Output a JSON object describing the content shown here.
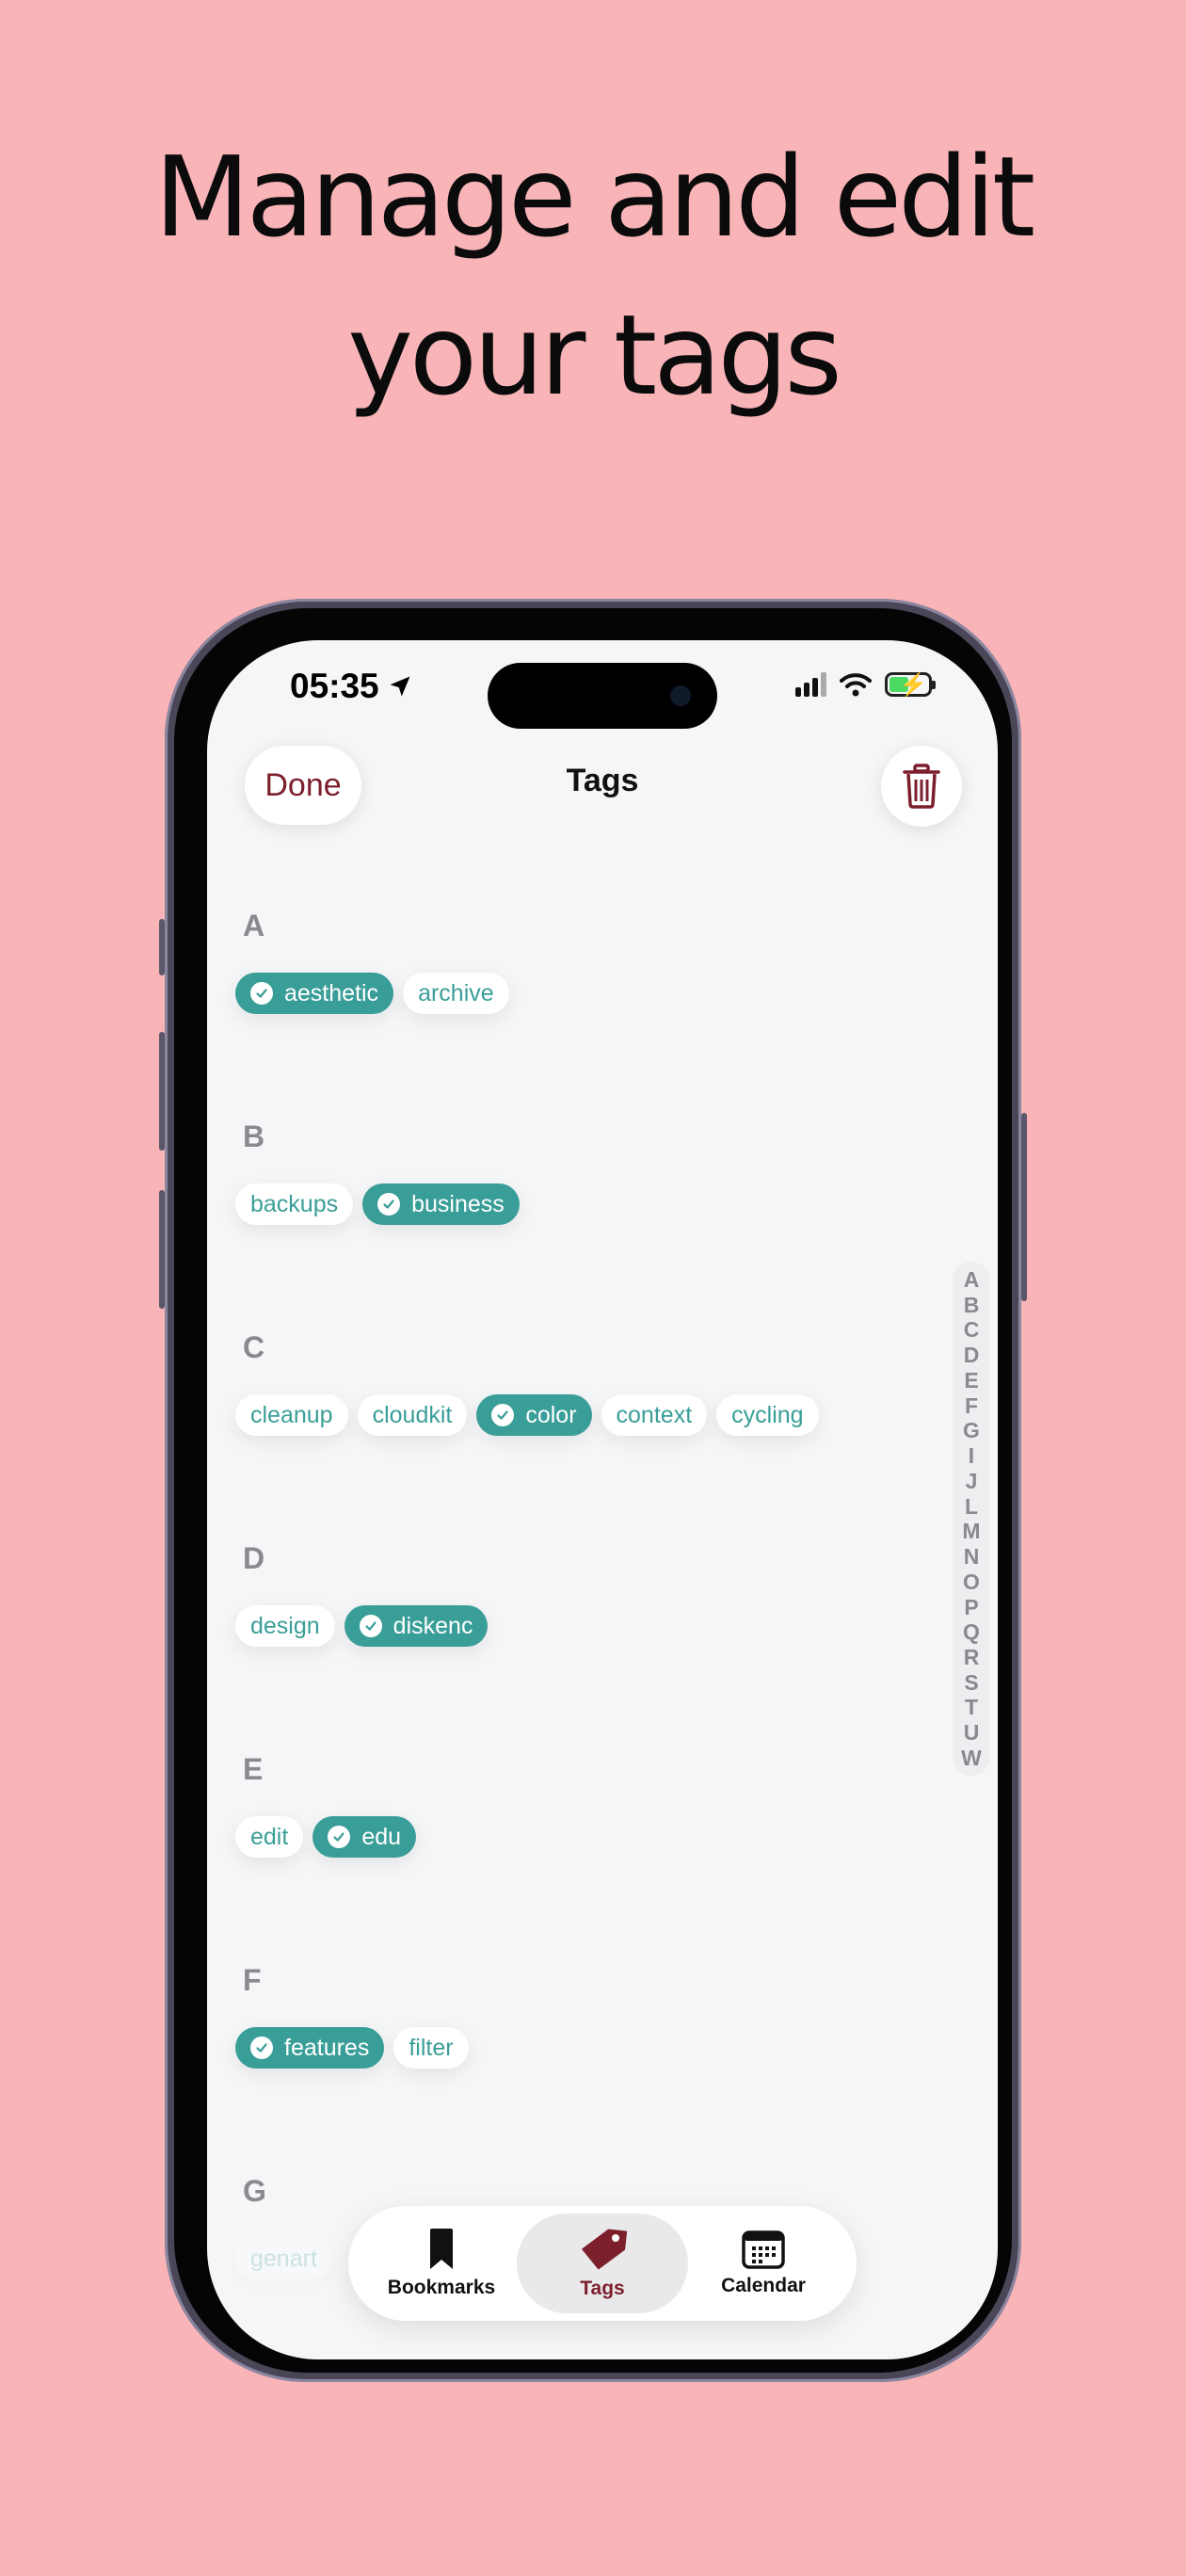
{
  "headline": {
    "line1": "Manage and edit",
    "line2": "your tags"
  },
  "status_bar": {
    "time": "05:35"
  },
  "nav": {
    "title": "Tags",
    "done_label": "Done"
  },
  "icons": {
    "trash": "trash-icon",
    "location": "location-arrow-icon",
    "wifi": "wifi-icon",
    "battery": "battery-charging-icon",
    "check": "checkmark-icon"
  },
  "colors": {
    "background": "#f9b4b8",
    "accent": "#3a9e98",
    "brand": "#7c1f2c"
  },
  "sections": [
    {
      "letter": "A",
      "tags": [
        {
          "label": "aesthetic",
          "selected": true
        },
        {
          "label": "archive",
          "selected": false
        }
      ]
    },
    {
      "letter": "B",
      "tags": [
        {
          "label": "backups",
          "selected": false
        },
        {
          "label": "business",
          "selected": true
        }
      ]
    },
    {
      "letter": "C",
      "tags": [
        {
          "label": "cleanup",
          "selected": false
        },
        {
          "label": "cloudkit",
          "selected": false
        },
        {
          "label": "color",
          "selected": true
        },
        {
          "label": "context",
          "selected": false
        },
        {
          "label": "cycling",
          "selected": false
        }
      ]
    },
    {
      "letter": "D",
      "tags": [
        {
          "label": "design",
          "selected": false
        },
        {
          "label": "diskenc",
          "selected": true
        }
      ]
    },
    {
      "letter": "E",
      "tags": [
        {
          "label": "edit",
          "selected": false
        },
        {
          "label": "edu",
          "selected": true
        }
      ]
    },
    {
      "letter": "F",
      "tags": [
        {
          "label": "features",
          "selected": true
        },
        {
          "label": "filter",
          "selected": false
        }
      ]
    },
    {
      "letter": "G",
      "tags": [
        {
          "label": "genart",
          "selected": false
        }
      ]
    }
  ],
  "index_letters": [
    "A",
    "B",
    "C",
    "D",
    "E",
    "F",
    "G",
    "I",
    "J",
    "L",
    "M",
    "N",
    "O",
    "P",
    "Q",
    "R",
    "S",
    "T",
    "U",
    "W"
  ],
  "tab_bar": [
    {
      "label": "Bookmarks",
      "icon": "bookmark-icon",
      "active": false
    },
    {
      "label": "Tags",
      "icon": "tag-icon",
      "active": true
    },
    {
      "label": "Calendar",
      "icon": "calendar-icon",
      "active": false
    }
  ]
}
